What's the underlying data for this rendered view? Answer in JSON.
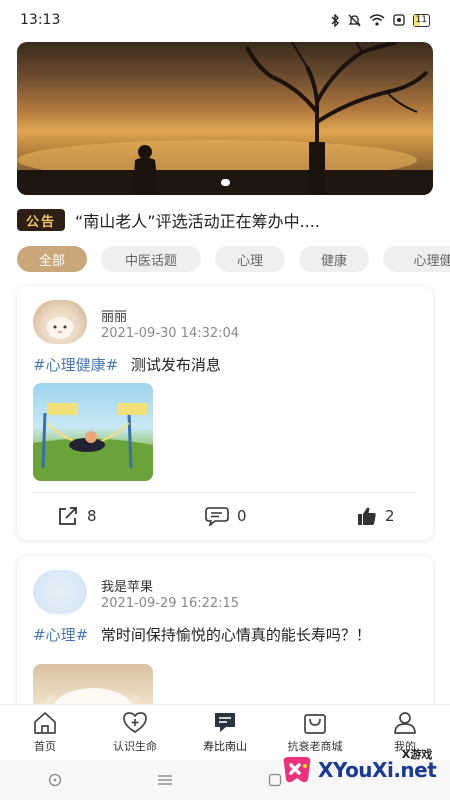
{
  "status_bar": {
    "time": "13:13",
    "battery": "11"
  },
  "notice": {
    "badge": "公告",
    "text": "“南山老人”评选活动正在筹办中...."
  },
  "tabs": [
    "全部",
    "中医话题",
    "心理",
    "健康",
    "心理健"
  ],
  "posts": [
    {
      "username": "丽丽",
      "time": "2021-09-30 14:32:04",
      "hashtag": "#心理健康#",
      "text": "测试发布消息",
      "shares": "8",
      "comments": "0",
      "likes": "2"
    },
    {
      "username": "我是苹果",
      "time": "2021-09-29 16:22:15",
      "hashtag": "#心理#",
      "text": "常时间保持愉悦的心情真的能长寿吗？！"
    }
  ],
  "tabbar": [
    {
      "label": "首页",
      "icon": "home-icon"
    },
    {
      "label": "认识生命",
      "icon": "heart-plus-icon"
    },
    {
      "label": "寿比南山",
      "icon": "chat-icon"
    },
    {
      "label": "抗衰老商城",
      "icon": "shopping-bag-icon"
    },
    {
      "label": "我的",
      "icon": "user-icon"
    }
  ],
  "watermark": {
    "main": "XYouXi.net",
    "small": "X游戏"
  }
}
